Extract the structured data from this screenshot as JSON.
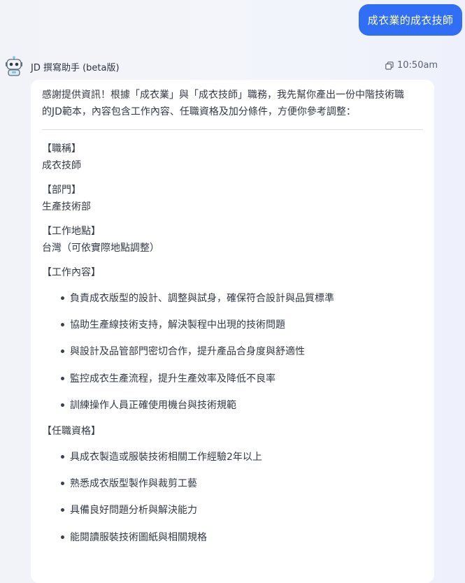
{
  "user_message": "成衣業的成衣技師",
  "bot": {
    "name": "JD 撰寫助手 (beta版)",
    "time": "10:50am"
  },
  "message": {
    "intro_line1": "感謝提供資訊！根據「成衣業」與「成衣技師」職務，我先幫你產出一份中階技術職",
    "intro_line2": "的JD範本，內容包含工作內容、任職資格及加分條件，方便你參考調整：",
    "title_label": "【職稱】",
    "title_value": "成衣技師",
    "dept_label": "【部門】",
    "dept_value": "生產技術部",
    "location_label": "【工作地點】",
    "location_value": "台灣（可依實際地點調整）",
    "duties_label": "【工作內容】",
    "duties": [
      "負責成衣版型的設計、調整與試身，確保符合設計與品質標準",
      "協助生產線技術支持，解決製程中出現的技術問題",
      "與設計及品管部門密切合作，提升產品合身度與舒適性",
      "監控成衣生產流程，提升生產效率及降低不良率",
      "訓練操作人員正確使用機台與技術規範"
    ],
    "qual_label": "【任職資格】",
    "qualifications": [
      "具成衣製造或服裝技術相關工作經驗2年以上",
      "熟悉成衣版型製作與裁剪工藝",
      "具備良好問題分析與解決能力",
      "能閱讀服裝技術圖紙與相關規格"
    ]
  }
}
